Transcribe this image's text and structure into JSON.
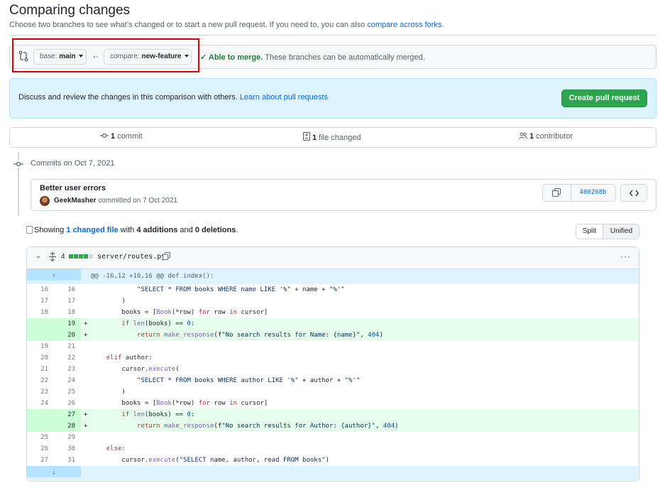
{
  "page": {
    "title": "Comparing changes",
    "subtitle_prefix": "Choose two branches to see what’s changed or to start a new pull request. If you need to, you can also ",
    "subtitle_link": "compare across forks",
    "subtitle_suffix": "."
  },
  "range": {
    "base_key": "base:",
    "base_value": "main",
    "compare_key": "compare:",
    "compare_value": "new-feature",
    "arrow": "←",
    "merge_ok": "Able to merge.",
    "merge_text": " These branches can be automatically merged."
  },
  "flash": {
    "text": "Discuss and review the changes in this comparison with others. ",
    "link": "Learn about pull requests",
    "button": "Create pull request"
  },
  "stats": {
    "commits_count": "1",
    "commits_label": " commit",
    "files_count": "1",
    "files_label": " file changed",
    "contributors_count": "1",
    "contributors_label": " contributor"
  },
  "commits": {
    "group_label": "Commits on Oct 7, 2021",
    "title": "Better user errors",
    "author": "GeekMasher",
    "meta": " committed on 7 Oct 2021",
    "sha": "400268b"
  },
  "diff_summary": {
    "prefix": "Showing ",
    "link": "1 changed file",
    "middle1": " with ",
    "additions": "4 additions",
    "middle2": " and ",
    "deletions": "0 deletions",
    "suffix": "."
  },
  "view_toggle": {
    "split": "Split",
    "unified": "Unified"
  },
  "file": {
    "changes": "4",
    "path": "server/routes.py",
    "hunk": "@@ -16,12 +16,16 @@ def index():",
    "lines": [
      {
        "o": "16",
        "n": "16",
        "s": " ",
        "c": "            \"SELECT * FROM books WHERE name LIKE '%\" + name + \"%'\"",
        "t": "ctx"
      },
      {
        "o": "17",
        "n": "17",
        "s": " ",
        "c": "        )",
        "t": "ctx"
      },
      {
        "o": "18",
        "n": "18",
        "s": " ",
        "c": "        books = [Book(*row) for row in cursor]",
        "t": "ctx"
      },
      {
        "o": "",
        "n": "19",
        "s": "+",
        "c": "        if len(books) == 0:",
        "t": "add"
      },
      {
        "o": "",
        "n": "20",
        "s": "+",
        "c": "            return make_response(f\"No search results for Name: {name}\", 404)",
        "t": "add"
      },
      {
        "o": "19",
        "n": "21",
        "s": " ",
        "c": "",
        "t": "ctx"
      },
      {
        "o": "20",
        "n": "22",
        "s": " ",
        "c": "    elif author:",
        "t": "ctx"
      },
      {
        "o": "21",
        "n": "23",
        "s": " ",
        "c": "        cursor.execute(",
        "t": "ctx"
      },
      {
        "o": "22",
        "n": "24",
        "s": " ",
        "c": "            \"SELECT * FROM books WHERE author LIKE '%\" + author + \"%'\"",
        "t": "ctx"
      },
      {
        "o": "23",
        "n": "25",
        "s": " ",
        "c": "        )",
        "t": "ctx"
      },
      {
        "o": "24",
        "n": "26",
        "s": " ",
        "c": "        books = [Book(*row) for row in cursor]",
        "t": "ctx"
      },
      {
        "o": "",
        "n": "27",
        "s": "+",
        "c": "        if len(books) == 0:",
        "t": "add"
      },
      {
        "o": "",
        "n": "28",
        "s": "+",
        "c": "            return make_response(f\"No search results for Author: {author}\", 404)",
        "t": "add"
      },
      {
        "o": "25",
        "n": "29",
        "s": " ",
        "c": "",
        "t": "ctx"
      },
      {
        "o": "26",
        "n": "30",
        "s": " ",
        "c": "    else:",
        "t": "ctx"
      },
      {
        "o": "27",
        "n": "31",
        "s": " ",
        "c": "        cursor.execute(\"SELECT name, author, read FROM books\")",
        "t": "ctx"
      }
    ]
  },
  "icons": {
    "compare": "git-compare-icon",
    "check": "check-icon",
    "commit": "git-commit-icon",
    "file": "file-diff-icon",
    "people": "people-icon",
    "copy": "copy-icon",
    "code": "code-icon",
    "expand": "unfold-icon",
    "kebab": "kebab-horizontal-icon"
  },
  "colors": {
    "accent": "#0969da",
    "success": "#1a7f37",
    "create_button": "#2da44e",
    "addition_bg": "#e6ffec",
    "hunk_bg": "#ddf4ff",
    "annotation_box": "#e00000"
  }
}
